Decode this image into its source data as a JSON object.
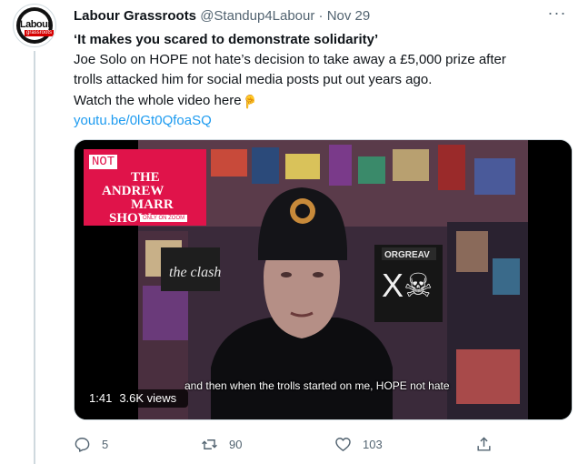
{
  "author": {
    "avatar_text": "Labour",
    "avatar_subtext": "grassroots",
    "name": "Labour Grassroots",
    "handle": "@Standup4Labour",
    "separator": "·",
    "date": "Nov 29"
  },
  "tweet": {
    "headline": "‘It makes you scared to demonstrate solidarity’",
    "line1": "Joe Solo on HOPE not hate’s decision to take away a £5,000 prize after",
    "line2": "trolls attacked him for social media posts put out years ago.",
    "line3": "Watch the whole video here",
    "emoji_icon": "pointing-down",
    "link": "youtu.be/0lGt0QfoaSQ"
  },
  "video": {
    "show_logo_not": "NOT",
    "show_logo_line1": "THE",
    "show_logo_line2": "ANDREW",
    "show_logo_line3": "MARR",
    "show_logo_line4": "SHOW",
    "show_logo_tag": "ONLY ON ZOOM",
    "poster_text": "the clash",
    "banner_text": "ORGREAV",
    "subtitle": "and then when the trolls started on me, HOPE not hate",
    "duration": "1:41",
    "views": "3.6K views"
  },
  "actions": {
    "reply_count": "5",
    "retweet_count": "90",
    "like_count": "103"
  },
  "colors": {
    "link": "#1d9bf0",
    "muted": "#536471",
    "show_red": "#e0134a"
  }
}
